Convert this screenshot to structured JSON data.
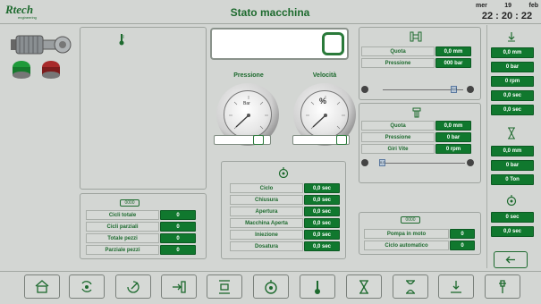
{
  "header": {
    "logo_text": "Rtech",
    "logo_sub": "engineering",
    "title": "Stato macchina",
    "date_day": "mer",
    "date_num": "19",
    "date_month": "feb",
    "time": "22 : 20 : 22"
  },
  "gauges": {
    "pressure_label": "Pressione",
    "pressure_unit": "Bar",
    "speed_label": "Velocità",
    "speed_unit": "%",
    "pressure_slider_fraction": 0.82,
    "speed_slider_fraction": 0.92
  },
  "cycle_counters": {
    "rows": [
      {
        "label": "Cicli totale",
        "value": "0"
      },
      {
        "label": "Cicli parziali",
        "value": "0"
      },
      {
        "label": "Totale pezzi",
        "value": "0"
      },
      {
        "label": "Parziale pezzi",
        "value": "0"
      }
    ]
  },
  "timers": {
    "rows": [
      {
        "label": "Ciclo",
        "value": "0,0 sec"
      },
      {
        "label": "Chiusura",
        "value": "0,0 sec"
      },
      {
        "label": "Apertura",
        "value": "0,0 sec"
      },
      {
        "label": "Macchina Aperta",
        "value": "0,0 sec"
      },
      {
        "label": "Iniezione",
        "value": "0,0 sec"
      },
      {
        "label": "Dosatura",
        "value": "0,0 sec"
      }
    ]
  },
  "clamp": {
    "rows": [
      {
        "label": "Quota",
        "value": "0,0 mm"
      },
      {
        "label": "Pressione",
        "value": "000 bar"
      }
    ],
    "slider_thumb_label": "0,0",
    "slider_fraction": 0.88
  },
  "injection": {
    "rows": [
      {
        "label": "Quota",
        "value": "0,0 mm"
      },
      {
        "label": "Pressione",
        "value": "0 bar"
      },
      {
        "label": "Giri Vite",
        "value": "0 rpm"
      }
    ],
    "slider_thumb_label": "0,0",
    "slider_fraction": 0.02
  },
  "status": {
    "rows": [
      {
        "label": "Pompa in moto",
        "value": "0"
      },
      {
        "label": "Ciclo automatico",
        "value": "0"
      }
    ]
  },
  "sidebar": {
    "group1": [
      "0,0 mm",
      "0 bar",
      "0 rpm",
      "0,0 sec",
      "0,0 sec"
    ],
    "group2": [
      "0,0 mm",
      "0 bar",
      "0 Ton"
    ],
    "group3": [
      "0 sec",
      "0,0 sec"
    ]
  },
  "nav_icons": [
    "home-icon",
    "cycle-refresh-icon",
    "injection-screw-icon",
    "ejector-icon",
    "hourglass-clamp-icon",
    "motor-icon",
    "thermometer-icon",
    "hourglass-icon",
    "hourglass-alt-icon",
    "gear-motor-icon",
    "tool-icon"
  ],
  "colors": {
    "accent": "#10782e",
    "background": "#d3d6d3",
    "title": "#1d6a2e"
  }
}
